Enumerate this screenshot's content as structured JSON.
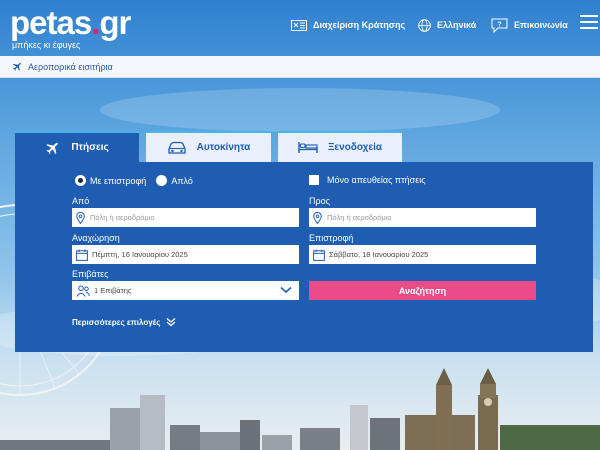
{
  "brand": {
    "name_main": "petas",
    "name_dot": ".",
    "name_tld": "gr",
    "tagline": "μπήκες κι έφυγες"
  },
  "header": {
    "manage_booking": "Διαχείριση Κράτησης",
    "language": "Ελληνικά",
    "contact": "Επικοινωνία"
  },
  "breadcrumb": {
    "label": "Αεροπορικά εισιτήρια"
  },
  "tabs": [
    {
      "label": "Πτήσεις",
      "icon": "plane-icon",
      "active": true
    },
    {
      "label": "Αυτοκίνητα",
      "icon": "car-icon",
      "active": false
    },
    {
      "label": "Ξενοδοχεία",
      "icon": "bed-icon",
      "active": false
    }
  ],
  "search": {
    "trip_type": {
      "round_trip": "Με επιστροφή",
      "one_way": "Απλό",
      "selected": "round_trip"
    },
    "direct_only": {
      "label": "Μόνο απευθείας πτήσεις",
      "checked": false
    },
    "from": {
      "label": "Από",
      "placeholder": "Πόλη ή αεροδρόμιο"
    },
    "to": {
      "label": "Προς",
      "placeholder": "Πόλη ή αεροδρόμιο"
    },
    "departure": {
      "label": "Αναχώρηση",
      "value": "Πέμπτη, 16 Ιανουαρίου 2025"
    },
    "return": {
      "label": "Επιστροφή",
      "value": "Σάββατο, 18 Ιανουαρίου 2025"
    },
    "passengers": {
      "label": "Επιβάτες",
      "value": "1 Επιβάτης"
    },
    "submit": "Αναζήτηση",
    "more_options": "Περισσότερες επιλογές"
  },
  "colors": {
    "panel": "#1e5db2",
    "accent_pink": "#ec4b89",
    "tab_border": "#49b6e8"
  }
}
